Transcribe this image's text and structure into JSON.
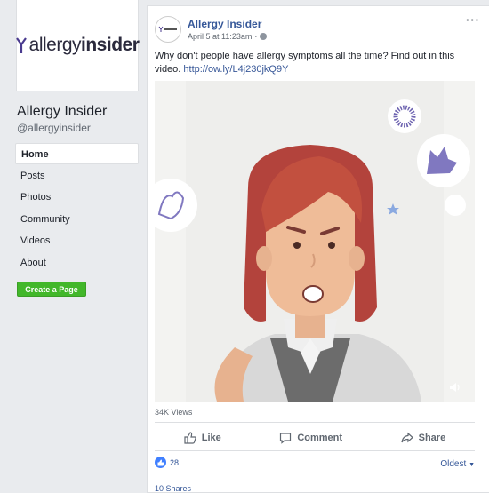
{
  "page": {
    "logo_light": "allergy",
    "logo_bold": "insider",
    "name": "Allergy Insider",
    "handle": "@allergyinsider"
  },
  "nav": [
    {
      "label": "Home",
      "active": true
    },
    {
      "label": "Posts"
    },
    {
      "label": "Photos"
    },
    {
      "label": "Community"
    },
    {
      "label": "Videos"
    },
    {
      "label": "About"
    }
  ],
  "create_page_label": "Create a Page",
  "post": {
    "author": "Allergy Insider",
    "timestamp": "April 5 at 11:23am",
    "dot": "·",
    "more": "···",
    "text": "Why don't people have allergy symptoms all the time? Find out in this video.",
    "link": "http://ow.ly/L4j230jkQ9Y",
    "views": "34K Views",
    "actions": {
      "like": "Like",
      "comment": "Comment",
      "share": "Share"
    },
    "reaction_count": "28",
    "sort_label": "Oldest",
    "shares": "10 Shares"
  },
  "icons": {
    "globe": "globe-icon",
    "like": "thumbs-up-icon",
    "comment": "comment-bubble-icon",
    "share": "share-arrow-icon",
    "volume": "volume-icon"
  },
  "colors": {
    "link": "#365899",
    "create_button": "#42b72a",
    "like_badge": "#4080ff",
    "hair": "#b3433c"
  }
}
